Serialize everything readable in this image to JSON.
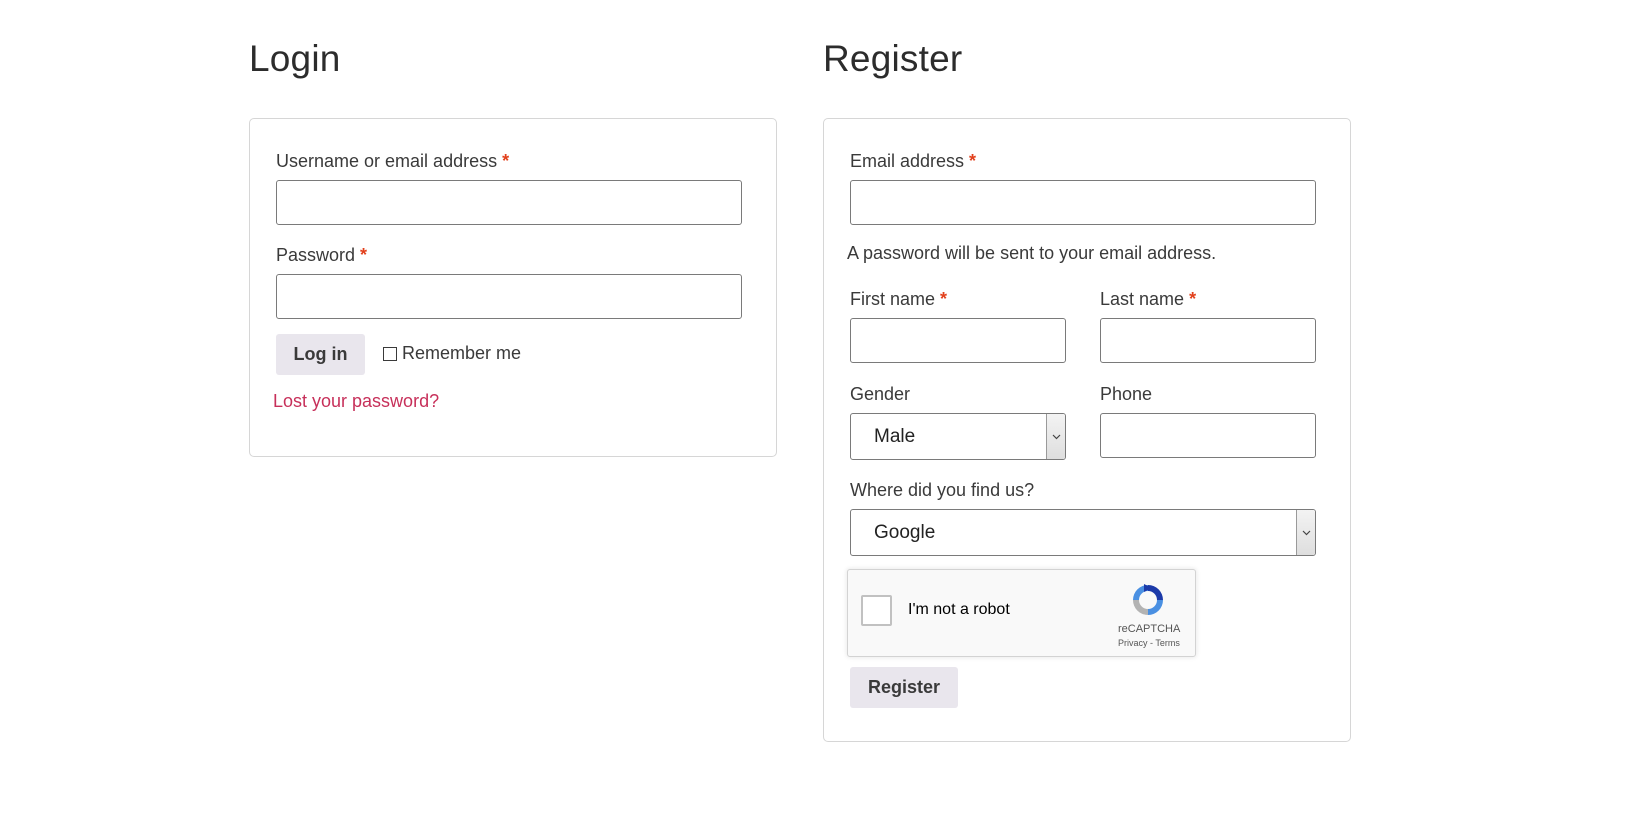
{
  "login": {
    "title": "Login",
    "username_label": "Username or email address",
    "username_required": "*",
    "username_value": "",
    "password_label": "Password",
    "password_required": "*",
    "password_value": "",
    "login_button": "Log in",
    "remember_label": "Remember me",
    "remember_checked": false,
    "lost_password": "Lost your password?"
  },
  "register": {
    "title": "Register",
    "email_label": "Email address",
    "email_required": "*",
    "email_value": "",
    "password_hint": "A password will be sent to your email address.",
    "first_name_label": "First name",
    "first_name_required": "*",
    "last_name_label": "Last name",
    "last_name_required": "*",
    "gender_label": "Gender",
    "gender_value": "Male",
    "phone_label": "Phone",
    "source_label": "Where did you find us?",
    "source_value": "Google",
    "recaptcha": {
      "label": "I'm not a robot",
      "brand": "reCAPTCHA",
      "links": "Privacy - Terms"
    },
    "register_button": "Register"
  },
  "colors": {
    "link": "#c7305a",
    "required": "#e2401c",
    "button_bg": "#e9e6ed"
  }
}
